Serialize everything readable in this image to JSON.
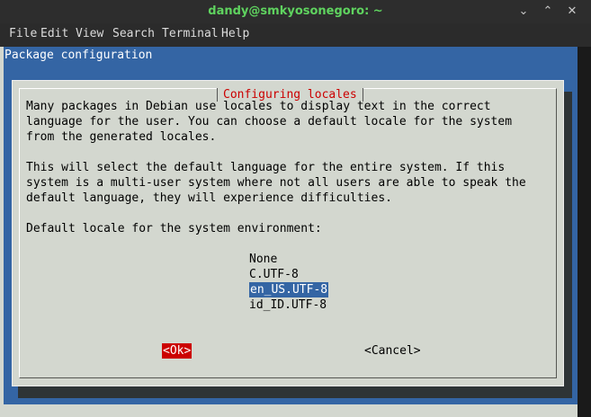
{
  "window": {
    "title": "dandy@smkyosonegoro: ~",
    "controls": [
      "chevron-down-icon",
      "chevron-up-icon",
      "close-icon"
    ],
    "minimize_glyph": "⌄",
    "maximize_glyph": "⌃",
    "close_glyph": "✕"
  },
  "menu": [
    "File",
    "Edit",
    "View",
    "Search",
    "Terminal",
    "Help"
  ],
  "terminal": {
    "screen_title": "Package configuration",
    "dialog": {
      "title": "Configuring locales",
      "paragraph1": [
        "Many packages in Debian use locales to display text in the correct",
        "language for the user. You can choose a default locale for the system",
        "from the generated locales."
      ],
      "paragraph2": [
        "This will select the default language for the entire system. If this",
        "system is a multi-user system where not all users are able to speak the",
        "default language, they will experience difficulties."
      ],
      "prompt": "Default locale for the system environment:",
      "options": [
        "None",
        "C.UTF-8",
        "en_US.UTF-8",
        "id_ID.UTF-8"
      ],
      "selected_option": "en_US.UTF-8",
      "ok_label": "<Ok>",
      "cancel_label": "<Cancel>"
    }
  },
  "colors": {
    "title_green": "#5fd35f",
    "dialog_bg": "#d3d7cf",
    "screen_blue": "#3465a4",
    "title_red": "#cc0000",
    "selection_blue": "#3465a4"
  }
}
